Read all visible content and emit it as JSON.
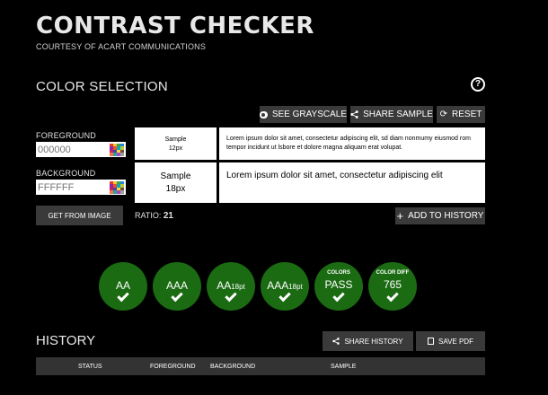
{
  "header": {
    "title": "CONTRAST CHECKER",
    "subtitle": "COURTESY OF ACART COMMUNICATIONS"
  },
  "color_selection": {
    "title": "COLOR SELECTION",
    "help_icon": "?",
    "buttons": {
      "grayscale": "SEE GRAYSCALE",
      "share": "SHARE SAMPLE",
      "reset": "RESET"
    },
    "foreground": {
      "label": "FOREGROUND",
      "placeholder": "000000"
    },
    "background": {
      "label": "BACKGROUND",
      "placeholder": "FFFFFF"
    },
    "get_from_image": "GET FROM IMAGE",
    "ratio_label": "RATIO:",
    "ratio_value": "21",
    "add_to_history": "ADD TO HISTORY"
  },
  "samples": {
    "small": {
      "label_line1": "Sample",
      "label_line2": "12px",
      "text": "Lorem ipsum dolor sit amet, consectetur adipiscing elit, sd diam nonmumy eiusmod rom tempor incidunt ut lsbore et dolore magna aliquam erat volupat."
    },
    "large": {
      "label_line1": "Sample",
      "label_line2": "18px",
      "text": "Lorem ipsum dolor sit amet, consectetur adipiscing elit"
    }
  },
  "badges": [
    {
      "small": "",
      "main": "AA",
      "suffix": "",
      "passed": true
    },
    {
      "small": "",
      "main": "AAA",
      "suffix": "",
      "passed": true
    },
    {
      "small": "",
      "main": "AA",
      "suffix": "18pt",
      "passed": true
    },
    {
      "small": "",
      "main": "AAA",
      "suffix": "18pt",
      "passed": true
    },
    {
      "small": "COLORS",
      "main": "PASS",
      "suffix": "",
      "passed": true
    },
    {
      "small": "COLOR DIFF",
      "main": "765",
      "suffix": "",
      "passed": true
    }
  ],
  "history": {
    "title": "HISTORY",
    "share_button": "SHARE HISTORY",
    "pdf_button": "SAVE PDF",
    "columns": [
      "STATUS",
      "FOREGROUND",
      "BACKGROUND",
      "SAMPLE"
    ]
  },
  "colors": {
    "button_bg": "#3a3a3a",
    "badge_green": "#1a6b12",
    "header_bg": "#333333"
  },
  "icons": {
    "help": "question-circle-icon",
    "grayscale": "toggle-icon",
    "share": "share-icon",
    "reset": "refresh-icon",
    "palette": "color-palette-icon",
    "add": "plus-icon",
    "check": "check-icon",
    "pdf": "pdf-icon"
  }
}
